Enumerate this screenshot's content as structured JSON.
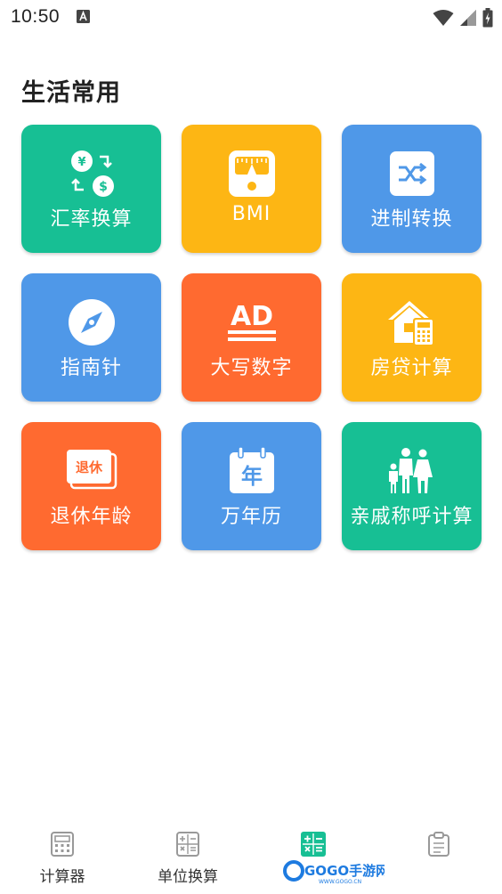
{
  "status_bar": {
    "time": "10:50"
  },
  "section": {
    "title": "生活常用"
  },
  "tiles": [
    {
      "label": "汇率换算",
      "color": "#17bf94",
      "icon": "currency-exchange-icon"
    },
    {
      "label": "BMI",
      "color": "#fdb614",
      "icon": "scale-icon"
    },
    {
      "label": "进制转换",
      "color": "#4f98e8",
      "icon": "base-convert-icon"
    },
    {
      "label": "指南针",
      "color": "#4f98e8",
      "icon": "compass-icon"
    },
    {
      "label": "大写数字",
      "color": "#ff6a30",
      "icon": "uppercase-digits-icon"
    },
    {
      "label": "房贷计算",
      "color": "#fdb614",
      "icon": "house-loan-icon"
    },
    {
      "label": "退休年龄",
      "color": "#ff6a30",
      "icon": "retirement-icon"
    },
    {
      "label": "万年历",
      "color": "#4f98e8",
      "icon": "calendar-icon"
    },
    {
      "label": "亲戚称呼计算",
      "color": "#17bf94",
      "icon": "family-icon"
    }
  ],
  "icon_text": {
    "yuan": "¥",
    "dollar": "$",
    "ad": "AD",
    "retire": "退休",
    "year": "年"
  },
  "tabbar": {
    "tabs": [
      {
        "label": "计算器",
        "icon": "calculator-icon",
        "active": false
      },
      {
        "label": "单位换算",
        "icon": "unit-convert-icon",
        "active": false
      },
      {
        "label": "",
        "icon": "tools-icon",
        "active": true
      },
      {
        "label": "",
        "icon": "clipboard-icon",
        "active": false
      }
    ],
    "active_color": "#17bf94",
    "inactive_color": "#999999"
  },
  "watermark": {
    "text": "GOGO手游网",
    "subtext": "WWW.GOGO.CN"
  }
}
